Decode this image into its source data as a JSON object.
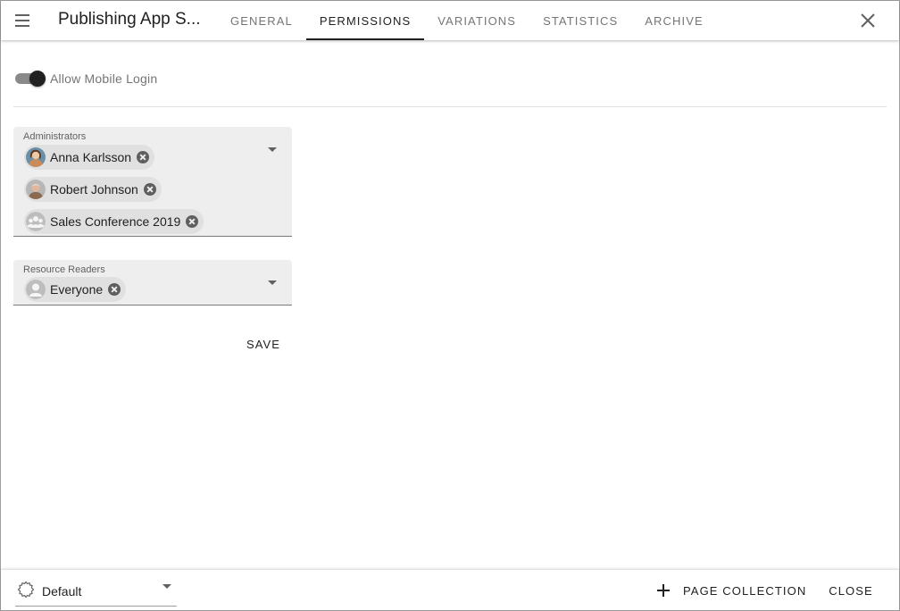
{
  "header": {
    "title": "Publishing App S...",
    "tabs": [
      {
        "label": "GENERAL",
        "active": false
      },
      {
        "label": "PERMISSIONS",
        "active": true
      },
      {
        "label": "VARIATIONS",
        "active": false
      },
      {
        "label": "STATISTICS",
        "active": false
      },
      {
        "label": "ARCHIVE",
        "active": false
      }
    ],
    "menu_icon": "hamburger-menu-icon",
    "close_icon": "close-icon"
  },
  "settings": {
    "mobile_login_label": "Allow Mobile Login",
    "mobile_login_enabled": true
  },
  "administrators": {
    "label": "Administrators",
    "chips": [
      {
        "text": "Anna Karlsson",
        "avatar": "person-photo"
      },
      {
        "text": "Robert Johnson",
        "avatar": "person-photo"
      },
      {
        "text": "Sales Conference 2019",
        "avatar": "group-icon"
      }
    ]
  },
  "resource_readers": {
    "label": "Resource Readers",
    "chips": [
      {
        "text": "Everyone",
        "avatar": "person-icon"
      }
    ]
  },
  "actions": {
    "save_label": "SAVE"
  },
  "footer": {
    "theme_value": "Default",
    "theme_icon": "gear-icon",
    "page_collection_label": "PAGE COLLECTION",
    "page_collection_icon": "plus-icon",
    "close_label": "CLOSE"
  },
  "colors": {
    "field_background": "#eeeeee",
    "chip_background": "#e0e0e0",
    "toggle_thumb": "#212121",
    "text_primary": "#212121",
    "text_secondary": "#757575"
  }
}
